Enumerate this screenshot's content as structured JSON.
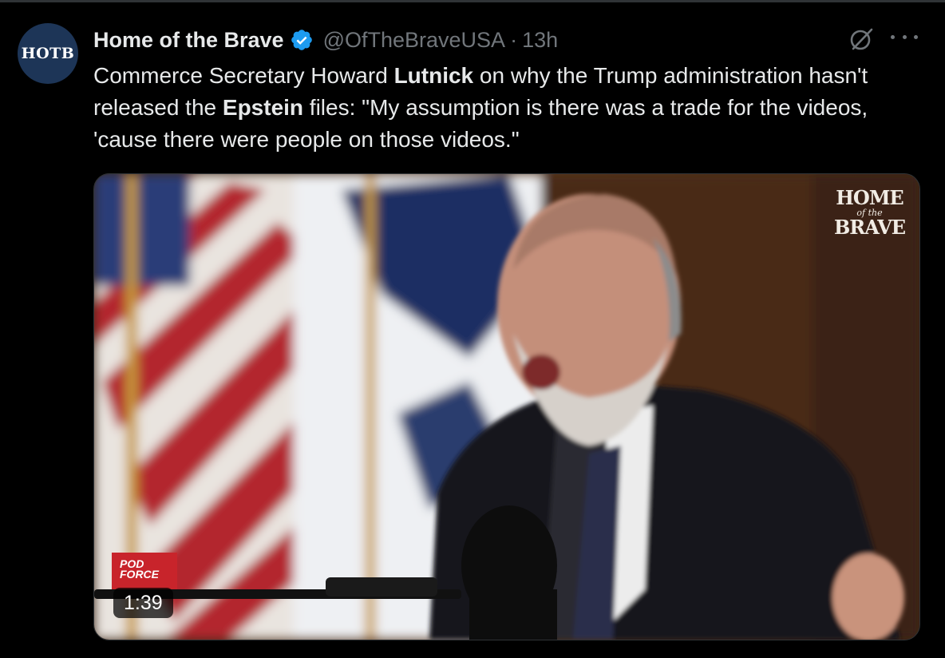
{
  "tweet": {
    "avatar_text": "HOTB",
    "author_name": "Home of the Brave",
    "handle": "@OfTheBraveUSA",
    "separator": "·",
    "time": "13h",
    "text_parts": [
      "Commerce Secretary Howard ",
      "Lutnick",
      " on why the Trump administration hasn't released the ",
      "Epstein",
      " files: \"My assumption is there was a trade for the videos, 'cause there were people on those videos.\""
    ]
  },
  "media": {
    "watermark_line1": "HOME",
    "watermark_line2": "of the",
    "watermark_line3": "BRAVE",
    "badge_line1": "POD",
    "badge_line2": "FORCE",
    "duration": "1:39"
  },
  "icons": {
    "verified": "verified-badge-icon",
    "grok": "grok-icon",
    "more": "more-icon"
  },
  "colors": {
    "background": "#000000",
    "text": "#e7e9ea",
    "secondary": "#71767b",
    "verified": "#1d9bf0"
  }
}
